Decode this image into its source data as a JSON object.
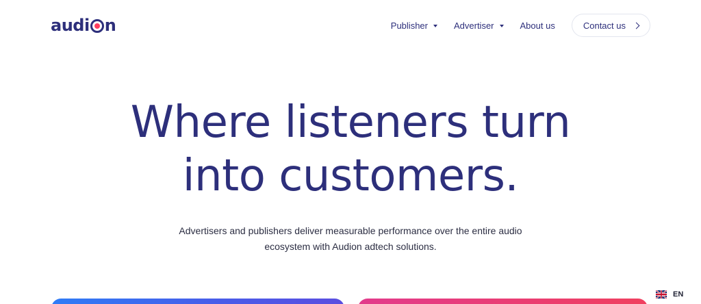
{
  "header": {
    "logo_text_start": "audi",
    "logo_text_end": "n",
    "nav": [
      {
        "label": "Publisher"
      },
      {
        "label": "Advertiser"
      },
      {
        "label": "About us"
      }
    ],
    "contact_label": "Contact us"
  },
  "hero": {
    "title_line1": "Where listeners turn",
    "title_line2": "into customers.",
    "subtitle_line1": "Advertisers and publishers deliver measurable performance over the entire audio",
    "subtitle_line2": "ecosystem with Audion adtech solutions."
  },
  "language": {
    "code": "EN",
    "flag": "uk-flag-icon"
  },
  "colors": {
    "brand_navy": "#2d2f7b",
    "brand_red": "#ff3d5e",
    "card_blue": "#2f7cf6",
    "card_pink": "#e23b8c"
  }
}
